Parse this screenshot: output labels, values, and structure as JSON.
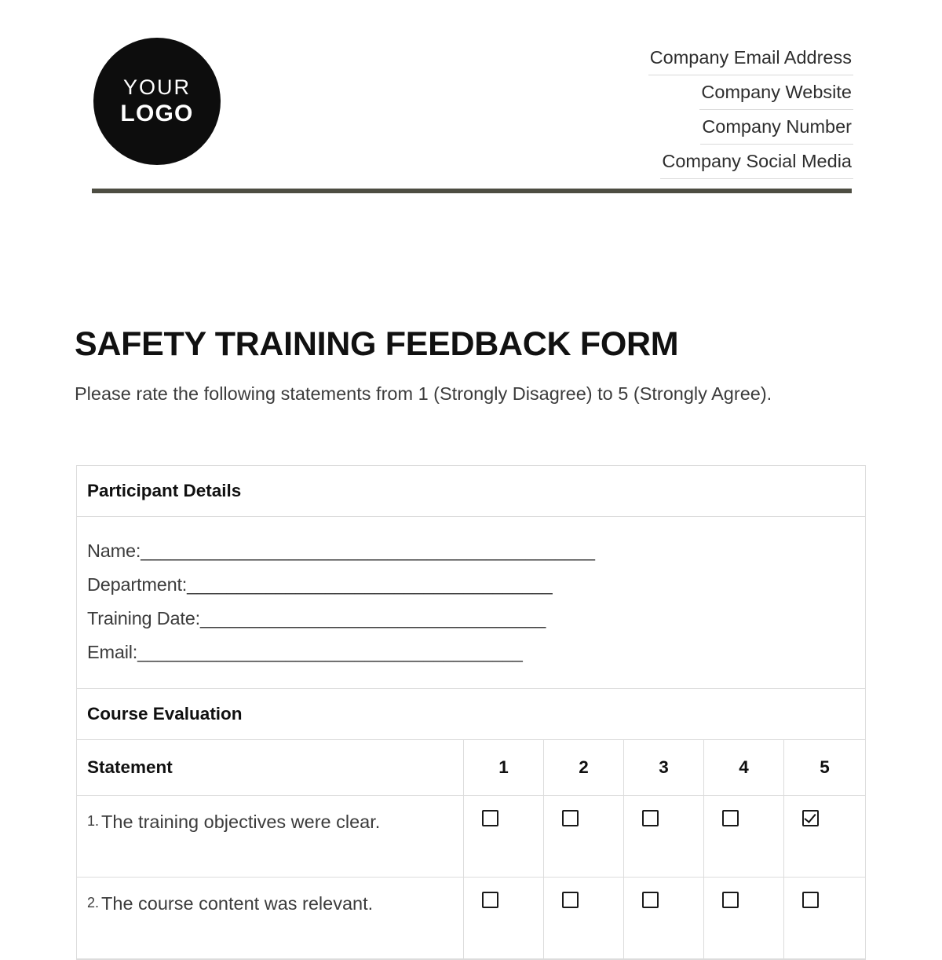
{
  "header": {
    "logo": {
      "line1": "YOUR",
      "line2": "LOGO"
    },
    "contacts": [
      "Company Email Address",
      "Company Website",
      "Company Number",
      "Company Social Media"
    ],
    "divider_color": "#4d4d42"
  },
  "title": "SAFETY TRAINING FEEDBACK FORM",
  "subtitle": "Please rate the following statements from 1 (Strongly Disagree) to 5 (Strongly Agree).",
  "participant": {
    "section_title": "Participant Details",
    "fields": [
      {
        "label": "Name:",
        "fill": "______________________________________________"
      },
      {
        "label": "Department:",
        "fill": "_____________________________________"
      },
      {
        "label": "Training Date:",
        "fill": "___________________________________"
      },
      {
        "label": "Email:",
        "fill": "_______________________________________"
      }
    ]
  },
  "evaluation": {
    "section_title": "Course Evaluation",
    "statement_header": "Statement",
    "scale_headers": [
      "1",
      "2",
      "3",
      "4",
      "5"
    ],
    "rows": [
      {
        "number": "1.",
        "text": "The training objectives were clear.",
        "checked": [
          false,
          false,
          false,
          false,
          true
        ]
      },
      {
        "number": "2.",
        "text": "The course content was relevant.",
        "checked": [
          false,
          false,
          false,
          false,
          false
        ]
      }
    ]
  }
}
